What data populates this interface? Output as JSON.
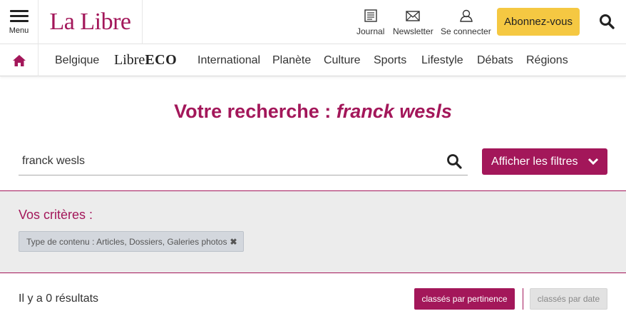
{
  "header": {
    "menu_label": "Menu",
    "logo_text": "La Libre",
    "tools": [
      {
        "label": "Journal",
        "icon": "newspaper-icon"
      },
      {
        "label": "Newsletter",
        "icon": "envelope-icon"
      },
      {
        "label": "Se connecter",
        "icon": "user-icon"
      }
    ],
    "subscribe_label": "Abonnez-vous",
    "search_icon": "search-icon"
  },
  "nav": {
    "home_icon": "home-icon",
    "items": [
      "Belgique",
      "International",
      "Planète",
      "Culture",
      "Sports",
      "Lifestyle",
      "Débats",
      "Régions"
    ],
    "eco_prefix": "Libre",
    "eco_suffix": "ECO"
  },
  "search": {
    "title_prefix": "Votre recherche : ",
    "query": "franck wesls",
    "input_value": "franck wesls",
    "filters_button": "Afficher les filtres"
  },
  "criteria": {
    "title": "Vos critères :",
    "chip_label": "Type de contenu : Articles, Dossiers, Galeries photos",
    "chip_remove": "✖"
  },
  "results": {
    "count_text": "Il y a 0 résultats",
    "sort_relevance": "classés par pertinence",
    "sort_date": "classés par date"
  },
  "colors": {
    "brand": "#a3175a",
    "subscribe": "#f5c842"
  }
}
